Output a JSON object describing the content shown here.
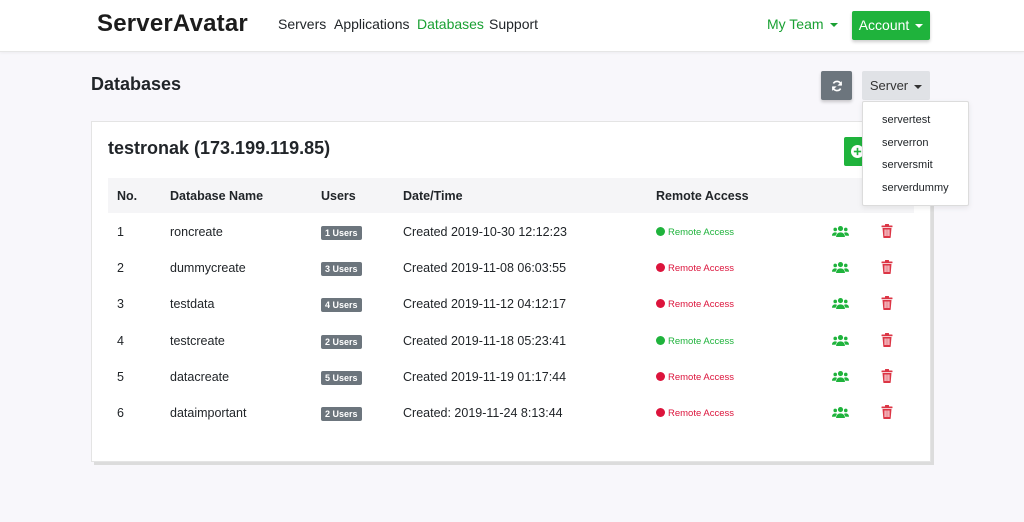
{
  "navbar": {
    "brand": "ServerAvatar",
    "links": [
      "Servers",
      "Applications",
      "Databases",
      "Support"
    ],
    "active_link": "Databases",
    "team_label": "My Team",
    "account_label": "Account"
  },
  "page": {
    "title": "Databases",
    "server_button_label": "Server"
  },
  "server_dropdown": {
    "options": [
      "servertest",
      "serverron",
      "serversmit",
      "serverdummy"
    ]
  },
  "card": {
    "title": "testronak (173.199.119.85)"
  },
  "table": {
    "headers": [
      "No.",
      "Database Name",
      "Users",
      "Date/Time",
      "Remote Access"
    ],
    "rows": [
      {
        "no": "1",
        "name": "roncreate",
        "users": "1 Users",
        "datetime": "Created 2019-10-30 12:12:23",
        "remote": "Remote Access",
        "remote_enabled": true
      },
      {
        "no": "2",
        "name": "dummycreate",
        "users": "3 Users",
        "datetime": "Created 2019-11-08 06:03:55",
        "remote": "Remote Access",
        "remote_enabled": false
      },
      {
        "no": "3",
        "name": "testdata",
        "users": "4 Users",
        "datetime": "Created 2019-11-12 04:12:17",
        "remote": "Remote Access",
        "remote_enabled": false
      },
      {
        "no": "4",
        "name": "testcreate",
        "users": "2 Users",
        "datetime": "Created 2019-11-18 05:23:41",
        "remote": "Remote Access",
        "remote_enabled": true
      },
      {
        "no": "5",
        "name": "datacreate",
        "users": "5 Users",
        "datetime": "Created 2019-11-19 01:17:44",
        "remote": "Remote Access",
        "remote_enabled": false
      },
      {
        "no": "6",
        "name": "dataimportant",
        "users": "2 Users",
        "datetime": "Created: 2019-11-24 8:13:44",
        "remote": "Remote Access",
        "remote_enabled": false
      }
    ]
  },
  "colors": {
    "accent_green": "#1fb33c",
    "link_green": "#1aa033",
    "remote_on": "#1fb33c",
    "remote_off": "#dc143c",
    "trash": "#dc3545",
    "badge": "#6c757d"
  },
  "icons": {
    "refresh": "refresh-icon",
    "add": "plus-circle-icon",
    "users": "users-icon",
    "delete": "trash-icon"
  }
}
